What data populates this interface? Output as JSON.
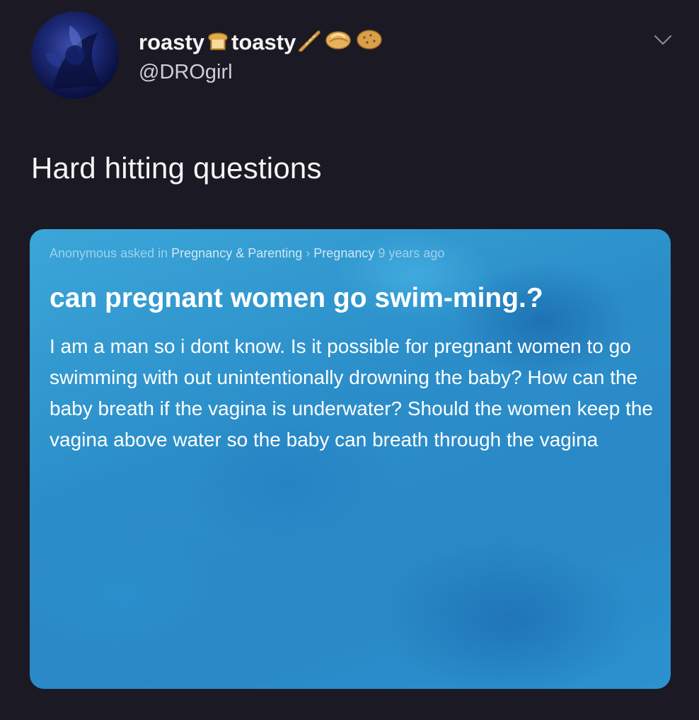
{
  "tweet": {
    "display_name_first": "roasty",
    "display_name_second": "toasty",
    "handle": "@DROgirl",
    "text": "Hard hitting questions",
    "icons": {
      "avatar": "avatar",
      "emoji_1": "bread-emoji",
      "emoji_2": "baguette-emoji",
      "emoji_3": "croissant-emoji",
      "emoji_4": "cookie-emoji",
      "menu": "chevron-down-icon"
    }
  },
  "question_card": {
    "author": "Anonymous",
    "asked_in": "asked in",
    "category": "Pregnancy & Parenting",
    "separator": "›",
    "subcategory": "Pregnancy",
    "age": "9 years ago",
    "title": "can pregnant women go swim-ming.?",
    "body": "I am a man so i dont know. Is it possible for pregnant women to go swimming with out unintentionally drowning the baby? How can the baby breath if the vagina is underwater? Should the women keep the vagina above water so the baby can breath through the vagina"
  },
  "colors": {
    "background": "#1b1a24",
    "card_blue": "#2b8ec9",
    "text": "#f2f2f2"
  }
}
